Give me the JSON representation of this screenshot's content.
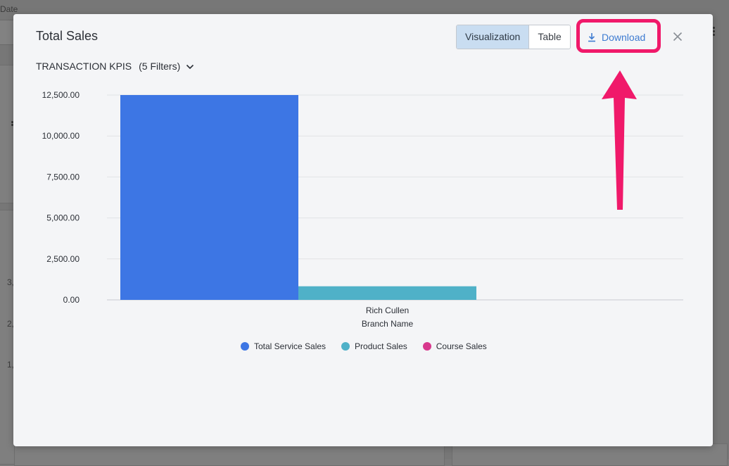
{
  "background": {
    "date_label": "Date",
    "left_ticks": [
      "3,",
      "2,",
      "1,"
    ]
  },
  "modal": {
    "title": "Total Sales",
    "view_toggle": {
      "visualization": "Visualization",
      "table": "Table",
      "active": "Visualization"
    },
    "download_label": "Download",
    "filter": {
      "name": "TRANSACTION KPIS",
      "count_label": "(5 Filters)"
    }
  },
  "colors": {
    "total_service": "#3d76e4",
    "product": "#4fb1c8",
    "course": "#d8388d",
    "annotation": "#f0196a"
  },
  "icons": [
    "download-icon",
    "close-icon",
    "chevron-down-icon"
  ],
  "chart_data": {
    "type": "bar",
    "categories": [
      "Rich Cullen"
    ],
    "series": [
      {
        "name": "Total Service Sales",
        "values": [
          12500
        ]
      },
      {
        "name": "Product Sales",
        "values": [
          830
        ]
      },
      {
        "name": "Course Sales",
        "values": [
          0
        ]
      }
    ],
    "xlabel": "Branch Name",
    "ylabel": "",
    "ylim": [
      0,
      12500
    ],
    "yticks": [
      0,
      2500,
      5000,
      7500,
      10000,
      12500
    ],
    "ytick_labels": [
      "0.00",
      "2,500.00",
      "5,000.00",
      "7,500.00",
      "10,000.00",
      "12,500.00"
    ],
    "grid": true,
    "legend": "bottom"
  }
}
